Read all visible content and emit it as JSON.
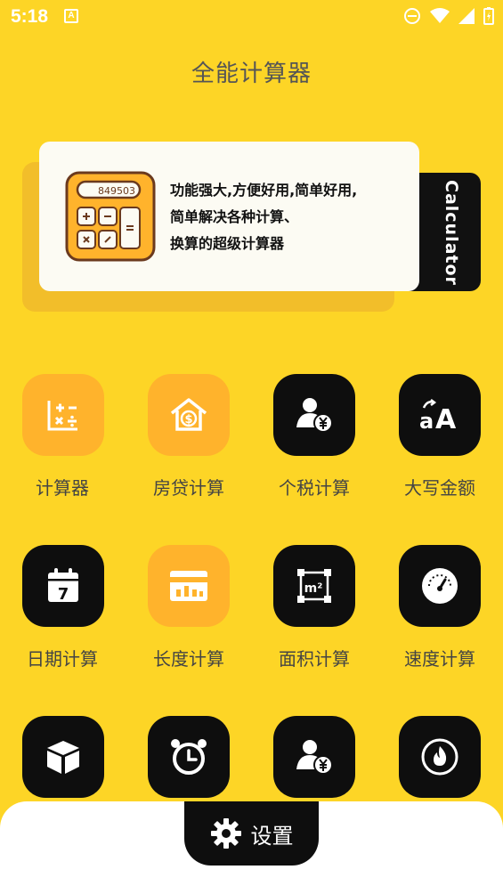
{
  "status": {
    "time": "5:18",
    "a_badge": "A"
  },
  "app": {
    "title": "全能计算器"
  },
  "hero": {
    "lines": [
      "功能强大,方便好用,简单好用,",
      "简单解决各种计算、",
      "换算的超级计算器"
    ],
    "display_value": "849503",
    "tab_label": "Calculator"
  },
  "tools": [
    {
      "label": "计算器",
      "icon": "calculator-icon",
      "style": "orange"
    },
    {
      "label": "房贷计算",
      "icon": "house-money-icon",
      "style": "orange"
    },
    {
      "label": "个税计算",
      "icon": "person-yen-icon",
      "style": "black"
    },
    {
      "label": "大写金额",
      "icon": "text-size-icon",
      "style": "black"
    },
    {
      "label": "日期计算",
      "icon": "calendar-icon",
      "style": "black"
    },
    {
      "label": "长度计算",
      "icon": "ruler-icon",
      "style": "orange"
    },
    {
      "label": "面积计算",
      "icon": "area-icon",
      "style": "black"
    },
    {
      "label": "速度计算",
      "icon": "speedometer-icon",
      "style": "black"
    },
    {
      "label": "",
      "icon": "cube-icon",
      "style": "black"
    },
    {
      "label": "",
      "icon": "alarm-clock-icon",
      "style": "black"
    },
    {
      "label": "",
      "icon": "person-yen-icon",
      "style": "black"
    },
    {
      "label": "",
      "icon": "flame-icon",
      "style": "black"
    }
  ],
  "nav": {
    "settings_label": "设置"
  },
  "colors": {
    "background": "#FDD526",
    "orange_tile": "#FFB32C",
    "black_tile": "#0E0E0E",
    "card": "#FCFBF3"
  }
}
